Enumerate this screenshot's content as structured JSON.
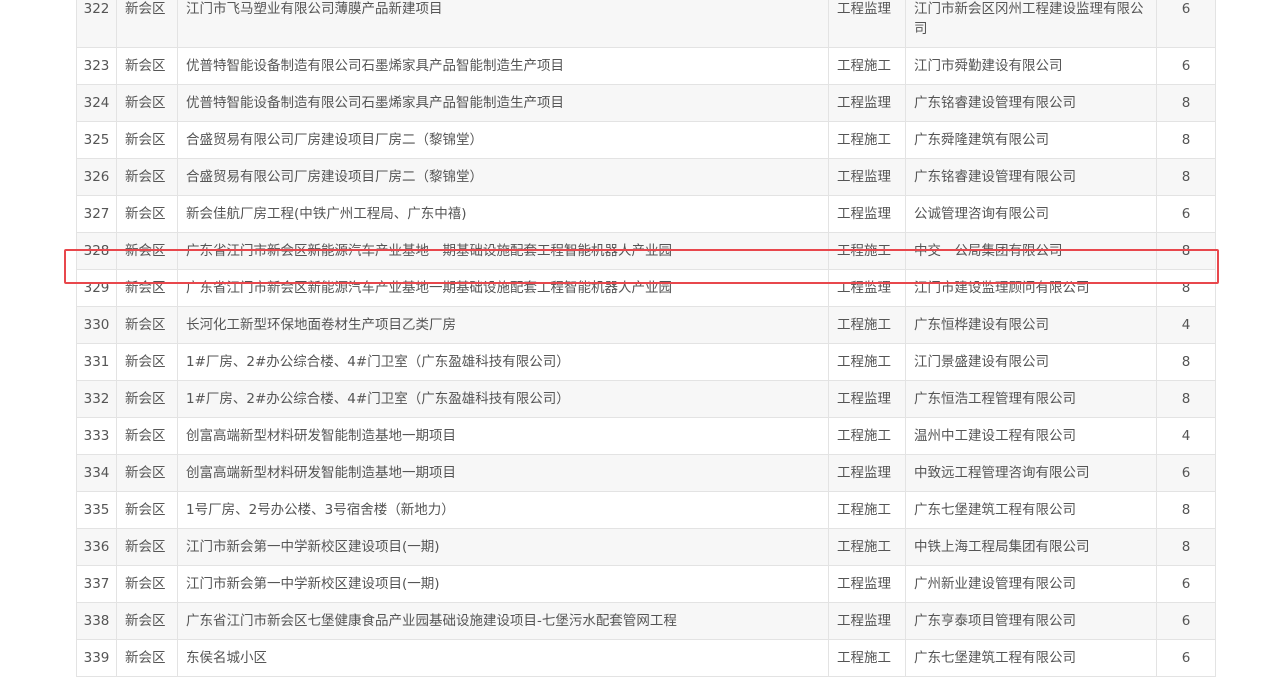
{
  "rows": [
    {
      "no": "322",
      "district": "新会区",
      "project": "江门市飞马塑业有限公司薄膜产品新建项目",
      "type": "工程监理",
      "company": "江门市新会区冈州工程建设监理有限公司",
      "count": "6"
    },
    {
      "no": "323",
      "district": "新会区",
      "project": "优普特智能设备制造有限公司石墨烯家具产品智能制造生产项目",
      "type": "工程施工",
      "company": "江门市舜勤建设有限公司",
      "count": "6"
    },
    {
      "no": "324",
      "district": "新会区",
      "project": "优普特智能设备制造有限公司石墨烯家具产品智能制造生产项目",
      "type": "工程监理",
      "company": "广东铭睿建设管理有限公司",
      "count": "8"
    },
    {
      "no": "325",
      "district": "新会区",
      "project": "合盛贸易有限公司厂房建设项目厂房二（黎锦堂）",
      "type": "工程施工",
      "company": "广东舜隆建筑有限公司",
      "count": "8"
    },
    {
      "no": "326",
      "district": "新会区",
      "project": "合盛贸易有限公司厂房建设项目厂房二（黎锦堂）",
      "type": "工程监理",
      "company": "广东铭睿建设管理有限公司",
      "count": "8"
    },
    {
      "no": "327",
      "district": "新会区",
      "project": "新会佳航厂房工程(中铁广州工程局、广东中禧)",
      "type": "工程监理",
      "company": "公诚管理咨询有限公司",
      "count": "6"
    },
    {
      "no": "328",
      "district": "新会区",
      "project": "广东省江门市新会区新能源汽车产业基地一期基础设施配套工程智能机器人产业园",
      "type": "工程施工",
      "company": "中交一公局集团有限公司",
      "count": "8"
    },
    {
      "no": "329",
      "district": "新会区",
      "project": "广东省江门市新会区新能源汽车产业基地一期基础设施配套工程智能机器人产业园",
      "type": "工程监理",
      "company": "江门市建设监理顾问有限公司",
      "count": "8"
    },
    {
      "no": "330",
      "district": "新会区",
      "project": "长河化工新型环保地面卷材生产项目乙类厂房",
      "type": "工程施工",
      "company": "广东恒桦建设有限公司",
      "count": "4"
    },
    {
      "no": "331",
      "district": "新会区",
      "project": "1#厂房、2#办公综合楼、4#门卫室（广东盈雄科技有限公司）",
      "type": "工程施工",
      "company": "江门景盛建设有限公司",
      "count": "8"
    },
    {
      "no": "332",
      "district": "新会区",
      "project": "1#厂房、2#办公综合楼、4#门卫室（广东盈雄科技有限公司）",
      "type": "工程监理",
      "company": "广东恒浩工程管理有限公司",
      "count": "8"
    },
    {
      "no": "333",
      "district": "新会区",
      "project": "创富高端新型材料研发智能制造基地一期项目",
      "type": "工程施工",
      "company": "温州中工建设工程有限公司",
      "count": "4"
    },
    {
      "no": "334",
      "district": "新会区",
      "project": "创富高端新型材料研发智能制造基地一期项目",
      "type": "工程监理",
      "company": "中致远工程管理咨询有限公司",
      "count": "6"
    },
    {
      "no": "335",
      "district": "新会区",
      "project": "1号厂房、2号办公楼、3号宿舍楼（新地力）",
      "type": "工程施工",
      "company": "广东七堡建筑工程有限公司",
      "count": "8"
    },
    {
      "no": "336",
      "district": "新会区",
      "project": "江门市新会第一中学新校区建设项目(一期)",
      "type": "工程施工",
      "company": "中铁上海工程局集团有限公司",
      "count": "8"
    },
    {
      "no": "337",
      "district": "新会区",
      "project": "江门市新会第一中学新校区建设项目(一期)",
      "type": "工程监理",
      "company": "广州新业建设管理有限公司",
      "count": "6"
    },
    {
      "no": "338",
      "district": "新会区",
      "project": "广东省江门市新会区七堡健康食品产业园基础设施建设项目-七堡污水配套管网工程",
      "type": "工程监理",
      "company": "广东亨泰项目管理有限公司",
      "count": "6"
    },
    {
      "no": "339",
      "district": "新会区",
      "project": "东侯名城小区",
      "type": "工程施工",
      "company": "广东七堡建筑工程有限公司",
      "count": "6"
    }
  ],
  "highlighted_row": "328"
}
